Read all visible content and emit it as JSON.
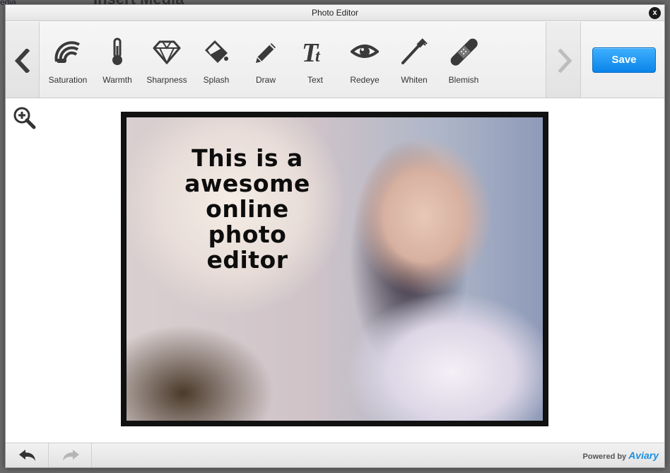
{
  "background": {
    "page_title": "Insert Media",
    "left_text": "edia"
  },
  "dialog": {
    "title": "Photo Editor",
    "close_label": "x"
  },
  "toolbar": {
    "tools": [
      {
        "label": "Saturation",
        "icon": "saturation-icon"
      },
      {
        "label": "Warmth",
        "icon": "thermometer-icon"
      },
      {
        "label": "Sharpness",
        "icon": "diamond-icon"
      },
      {
        "label": "Splash",
        "icon": "paint-bucket-icon"
      },
      {
        "label": "Draw",
        "icon": "pencil-icon"
      },
      {
        "label": "Text",
        "icon": "text-icon"
      },
      {
        "label": "Redeye",
        "icon": "eye-icon"
      },
      {
        "label": "Whiten",
        "icon": "toothbrush-icon"
      },
      {
        "label": "Blemish",
        "icon": "bandage-icon"
      }
    ],
    "save_label": "Save"
  },
  "canvas": {
    "zoom_icon": "zoom-in-icon",
    "photo_text_lines": [
      "This is a",
      "awesome",
      "online",
      "photo",
      "editor"
    ]
  },
  "footer": {
    "powered_by": "Powered by",
    "brand": "Aviary"
  }
}
